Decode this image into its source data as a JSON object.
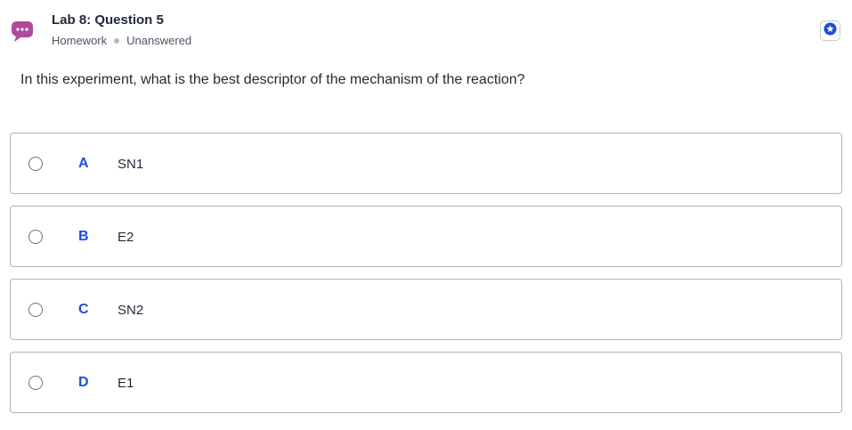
{
  "header": {
    "title": "Lab 8: Question 5",
    "category": "Homework",
    "status": "Unanswered",
    "chat_icon": "chat-bubble-icon",
    "star_icon": "star-icon"
  },
  "question": {
    "text": "In this experiment, what is the best descriptor of the mechanism of the reaction?"
  },
  "options": [
    {
      "letter": "A",
      "text": "SN1"
    },
    {
      "letter": "B",
      "text": "E2"
    },
    {
      "letter": "C",
      "text": "SN2"
    },
    {
      "letter": "D",
      "text": "E1"
    }
  ],
  "colors": {
    "accent": "#1d4ed8",
    "chat_icon": "#b04a9a",
    "border": "#aeb4bd"
  }
}
